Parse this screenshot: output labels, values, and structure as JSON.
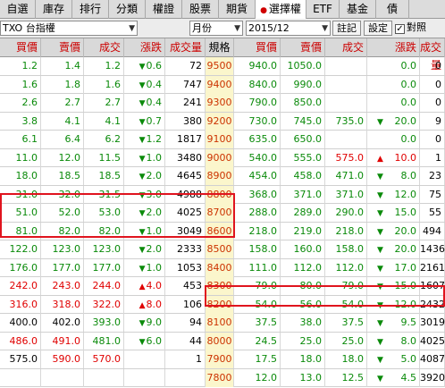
{
  "tabs": [
    {
      "label": "自選",
      "w": 40
    },
    {
      "label": "庫存",
      "w": 41
    },
    {
      "label": "排行",
      "w": 41
    },
    {
      "label": "分類",
      "w": 41
    },
    {
      "label": "權證",
      "w": 41
    },
    {
      "label": "股票",
      "w": 41
    },
    {
      "label": "期貨",
      "w": 41
    },
    {
      "label": "選擇權",
      "w": 57,
      "active": true
    },
    {
      "label": "ETF",
      "w": 37
    },
    {
      "label": "基金",
      "w": 41
    },
    {
      "label": "債",
      "w": 37
    }
  ],
  "controls": {
    "product": "TXO 台指權",
    "period_type": "月份",
    "contract": "2015/12",
    "note_btn": "註記",
    "settings_btn": "設定",
    "checkbox_label": "對照"
  },
  "headers": {
    "call": [
      "買價",
      "賣價",
      "成交",
      "漲跌",
      "成交量"
    ],
    "strike": "規格",
    "put": [
      "買價",
      "賣價",
      "成交",
      "漲跌",
      "成交量"
    ]
  },
  "rows": [
    {
      "call": [
        "1.2",
        "1.4",
        "1.2",
        "0.6",
        "72"
      ],
      "cc": [
        "g",
        "g",
        "g",
        "g",
        "k"
      ],
      "cd": "down",
      "strike": "9500",
      "put": [
        "940.0",
        "1050.0",
        "",
        "",
        "0.0",
        "0"
      ],
      "pc": [
        "g",
        "g",
        "k",
        "k",
        "g",
        "k"
      ]
    },
    {
      "call": [
        "1.6",
        "1.8",
        "1.6",
        "0.4",
        "747"
      ],
      "cc": [
        "g",
        "g",
        "g",
        "g",
        "k"
      ],
      "cd": "down",
      "strike": "9400",
      "put": [
        "840.0",
        "990.0",
        "",
        "",
        "0.0",
        "0"
      ],
      "pc": [
        "g",
        "g",
        "k",
        "k",
        "g",
        "k"
      ]
    },
    {
      "call": [
        "2.6",
        "2.7",
        "2.7",
        "0.4",
        "241"
      ],
      "cc": [
        "g",
        "g",
        "g",
        "g",
        "k"
      ],
      "cd": "down",
      "strike": "9300",
      "put": [
        "790.0",
        "850.0",
        "",
        "",
        "0.0",
        "0"
      ],
      "pc": [
        "g",
        "g",
        "k",
        "k",
        "g",
        "k"
      ]
    },
    {
      "call": [
        "3.8",
        "4.1",
        "4.1",
        "0.7",
        "380"
      ],
      "cc": [
        "g",
        "g",
        "g",
        "g",
        "k"
      ],
      "cd": "down",
      "strike": "9200",
      "put": [
        "730.0",
        "745.0",
        "735.0",
        "",
        "20.0",
        "9"
      ],
      "pc": [
        "g",
        "g",
        "g",
        "k",
        "g",
        "k"
      ],
      "pd": "down"
    },
    {
      "call": [
        "6.1",
        "6.4",
        "6.2",
        "1.2",
        "1817"
      ],
      "cc": [
        "g",
        "g",
        "g",
        "g",
        "k"
      ],
      "cd": "down",
      "strike": "9100",
      "put": [
        "635.0",
        "650.0",
        "",
        "",
        "0.0",
        "0"
      ],
      "pc": [
        "g",
        "g",
        "k",
        "k",
        "g",
        "k"
      ]
    },
    {
      "call": [
        "11.0",
        "12.0",
        "11.5",
        "1.0",
        "3480"
      ],
      "cc": [
        "g",
        "g",
        "g",
        "g",
        "k"
      ],
      "cd": "down",
      "strike": "9000",
      "put": [
        "540.0",
        "555.0",
        "575.0",
        "",
        "10.0",
        "1"
      ],
      "pc": [
        "g",
        "g",
        "r",
        "k",
        "r",
        "k"
      ],
      "pd": "up"
    },
    {
      "call": [
        "18.0",
        "18.5",
        "18.5",
        "2.0",
        "4645"
      ],
      "cc": [
        "g",
        "g",
        "g",
        "g",
        "k"
      ],
      "cd": "down",
      "strike": "8900",
      "put": [
        "454.0",
        "458.0",
        "471.0",
        "",
        "8.0",
        "23"
      ],
      "pc": [
        "g",
        "g",
        "g",
        "k",
        "g",
        "k"
      ],
      "pd": "down"
    },
    {
      "call": [
        "31.0",
        "32.0",
        "31.5",
        "3.0",
        "4988"
      ],
      "cc": [
        "g",
        "g",
        "g",
        "g",
        "k"
      ],
      "cd": "down",
      "strike": "8800",
      "put": [
        "368.0",
        "371.0",
        "371.0",
        "",
        "12.0",
        "75"
      ],
      "pc": [
        "g",
        "g",
        "g",
        "k",
        "g",
        "k"
      ],
      "pd": "down"
    },
    {
      "call": [
        "51.0",
        "52.0",
        "53.0",
        "2.0",
        "4025"
      ],
      "cc": [
        "g",
        "g",
        "g",
        "g",
        "k"
      ],
      "cd": "down",
      "strike": "8700",
      "put": [
        "288.0",
        "289.0",
        "290.0",
        "",
        "15.0",
        "55"
      ],
      "pc": [
        "g",
        "g",
        "g",
        "k",
        "g",
        "k"
      ],
      "pd": "down"
    },
    {
      "call": [
        "81.0",
        "82.0",
        "82.0",
        "1.0",
        "3049"
      ],
      "cc": [
        "g",
        "g",
        "g",
        "g",
        "k"
      ],
      "cd": "down",
      "strike": "8600",
      "put": [
        "218.0",
        "219.0",
        "218.0",
        "",
        "20.0",
        "494"
      ],
      "pc": [
        "g",
        "g",
        "g",
        "k",
        "g",
        "k"
      ],
      "pd": "down"
    },
    {
      "call": [
        "122.0",
        "123.0",
        "123.0",
        "2.0",
        "2333"
      ],
      "cc": [
        "g",
        "g",
        "g",
        "g",
        "k"
      ],
      "cd": "down",
      "strike": "8500",
      "put": [
        "158.0",
        "160.0",
        "158.0",
        "",
        "20.0",
        "1436"
      ],
      "pc": [
        "g",
        "g",
        "g",
        "k",
        "g",
        "k"
      ],
      "pd": "down"
    },
    {
      "call": [
        "176.0",
        "177.0",
        "177.0",
        "1.0",
        "1053"
      ],
      "cc": [
        "g",
        "g",
        "g",
        "g",
        "k"
      ],
      "cd": "down",
      "strike": "8400",
      "put": [
        "111.0",
        "112.0",
        "112.0",
        "",
        "17.0",
        "2161"
      ],
      "pc": [
        "g",
        "g",
        "g",
        "k",
        "g",
        "k"
      ],
      "pd": "down"
    },
    {
      "call": [
        "242.0",
        "243.0",
        "244.0",
        "4.0",
        "453"
      ],
      "cc": [
        "r",
        "r",
        "r",
        "r",
        "k"
      ],
      "cd": "up",
      "strike": "8300",
      "put": [
        "79.0",
        "80.0",
        "79.0",
        "",
        "15.0",
        "1607"
      ],
      "pc": [
        "g",
        "g",
        "g",
        "k",
        "g",
        "k"
      ],
      "pd": "down"
    },
    {
      "call": [
        "316.0",
        "318.0",
        "322.0",
        "8.0",
        "106"
      ],
      "cc": [
        "r",
        "r",
        "r",
        "r",
        "k"
      ],
      "cd": "up",
      "strike": "8200",
      "put": [
        "54.0",
        "56.0",
        "54.0",
        "",
        "12.0",
        "2432"
      ],
      "pc": [
        "g",
        "g",
        "g",
        "k",
        "g",
        "k"
      ],
      "pd": "down"
    },
    {
      "call": [
        "400.0",
        "402.0",
        "393.0",
        "9.0",
        "94"
      ],
      "cc": [
        "k",
        "k",
        "g",
        "g",
        "k"
      ],
      "cd": "down",
      "strike": "8100",
      "put": [
        "37.5",
        "38.0",
        "37.5",
        "",
        "9.5",
        "3019"
      ],
      "pc": [
        "g",
        "g",
        "g",
        "k",
        "g",
        "k"
      ],
      "pd": "down"
    },
    {
      "call": [
        "486.0",
        "491.0",
        "481.0",
        "6.0",
        "44"
      ],
      "cc": [
        "r",
        "r",
        "g",
        "g",
        "k"
      ],
      "cd": "down",
      "strike": "8000",
      "put": [
        "24.5",
        "25.0",
        "25.0",
        "",
        "8.0",
        "4025"
      ],
      "pc": [
        "g",
        "g",
        "g",
        "k",
        "g",
        "k"
      ],
      "pd": "down"
    },
    {
      "call": [
        "575.0",
        "590.0",
        "570.0",
        "",
        "1"
      ],
      "cc": [
        "k",
        "r",
        "r",
        "k",
        "k"
      ],
      "cd": "",
      "strike": "7900",
      "put": [
        "17.5",
        "18.0",
        "18.0",
        "",
        "5.0",
        "4087"
      ],
      "pc": [
        "g",
        "g",
        "g",
        "k",
        "g",
        "k"
      ],
      "pd": "down"
    },
    {
      "call": [
        "",
        "",
        "",
        "",
        ""
      ],
      "cc": [
        "k",
        "k",
        "k",
        "k",
        "k"
      ],
      "cd": "",
      "strike": "7800",
      "put": [
        "12.0",
        "13.0",
        "12.5",
        "",
        "4.5",
        "3920"
      ],
      "pc": [
        "g",
        "g",
        "g",
        "k",
        "g",
        "k"
      ],
      "pd": "down"
    }
  ]
}
